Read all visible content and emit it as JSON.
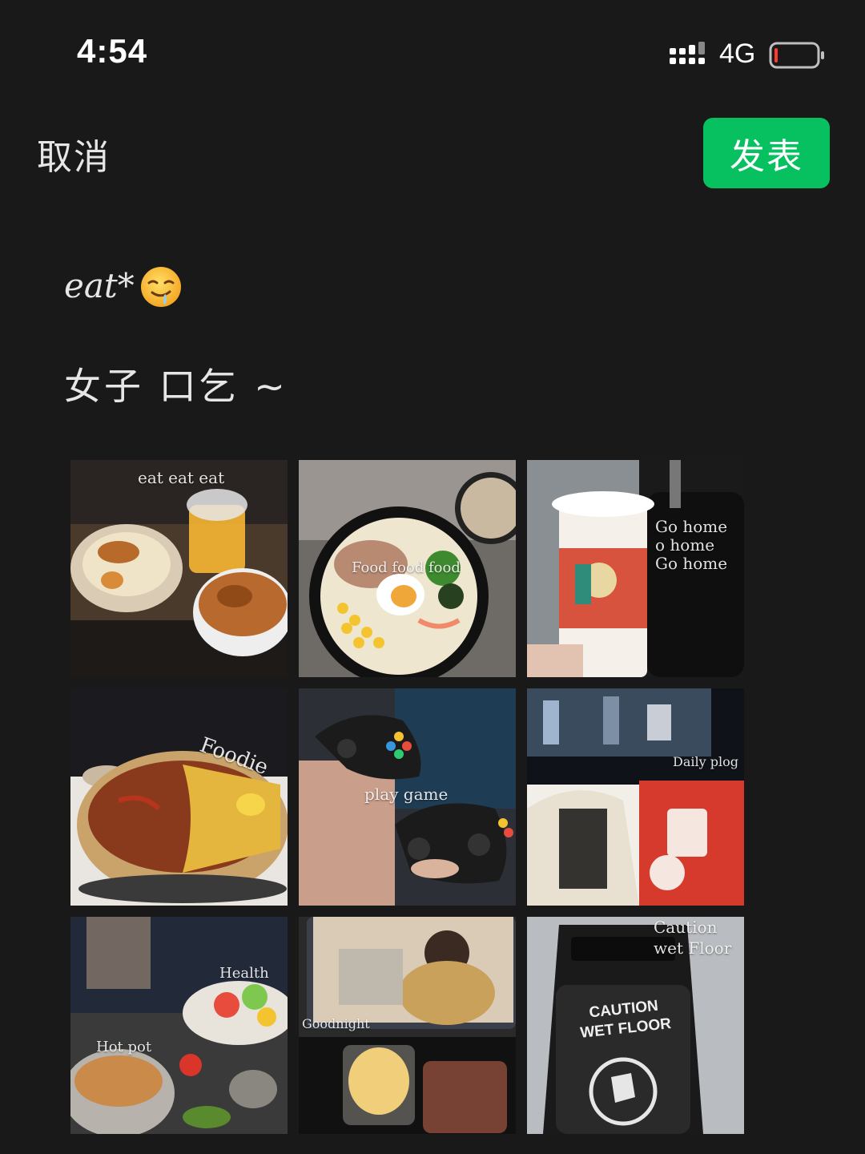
{
  "status_bar": {
    "time": "4:54",
    "network": "4G",
    "signal_icon": "signal-bars-icon",
    "battery_icon": "battery-low-icon",
    "battery_level": 0.05,
    "battery_color": "#ff3b30"
  },
  "header": {
    "cancel_label": "取消",
    "publish_label": "发表",
    "publish_color": "#07c160"
  },
  "post": {
    "line1_text": "eat*",
    "line1_emoji": "drooling-face-emoji",
    "line2_text": "女子 口乞 ~"
  },
  "photos": [
    {
      "caption": "eat eat eat",
      "subject": "ramen-and-juice"
    },
    {
      "caption": "Food food food",
      "subject": "ramen-bowl"
    },
    {
      "caption": "Go home\no home\nGo home",
      "subject": "milk-tea-and-suitcase"
    },
    {
      "caption": "Foodie",
      "subject": "hot-pot"
    },
    {
      "caption": "play game",
      "subject": "game-controllers"
    },
    {
      "caption": "Daily plog",
      "subject": "tv-and-snacks"
    },
    {
      "caption": "Health",
      "caption2": "Hot pot",
      "subject": "hot-pot-salad"
    },
    {
      "caption": "Goodnight",
      "subject": "tablet-and-pudding"
    },
    {
      "caption": "Caution\nwet Floor",
      "sign_text": "CAUTION\nWET FLOOR",
      "subject": "wet-floor-sign"
    }
  ]
}
